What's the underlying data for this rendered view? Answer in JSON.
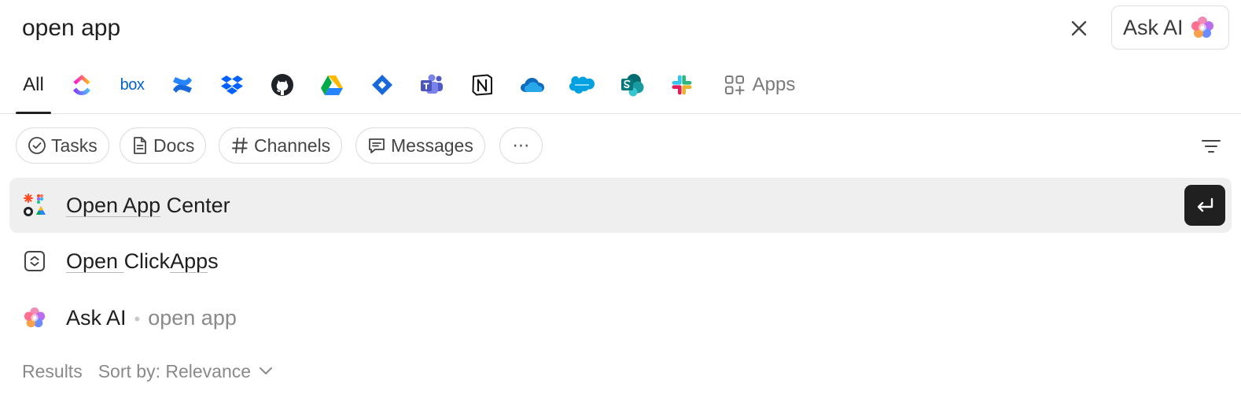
{
  "search": {
    "query": "open app"
  },
  "ask_ai_button": {
    "label": "Ask AI"
  },
  "tabs": {
    "all_label": "All",
    "sources": [
      "clickup",
      "box",
      "confluence",
      "dropbox",
      "github",
      "google-drive",
      "jira",
      "microsoft-teams",
      "notion",
      "onedrive",
      "salesforce",
      "sharepoint",
      "slack"
    ],
    "box_logo_text": "box",
    "apps_label": "Apps"
  },
  "filters": {
    "tasks": "Tasks",
    "docs": "Docs",
    "channels": "Channels",
    "messages": "Messages",
    "more": "⋯"
  },
  "results": [
    {
      "pre": "",
      "u1": "Open App",
      "post": " Center",
      "selected": true
    },
    {
      "pre": "",
      "u1": "Open ",
      "mid": "Click",
      "u2": "App",
      "post": "s"
    },
    {
      "label": "Ask AI",
      "separator": "•",
      "query": "open app"
    }
  ],
  "footer": {
    "results_label": "Results",
    "sort_label": "Sort by: Relevance"
  },
  "colors": {
    "selected_row": "#efefef",
    "enter_key": "#202020",
    "muted_text": "#8a8a8a"
  }
}
